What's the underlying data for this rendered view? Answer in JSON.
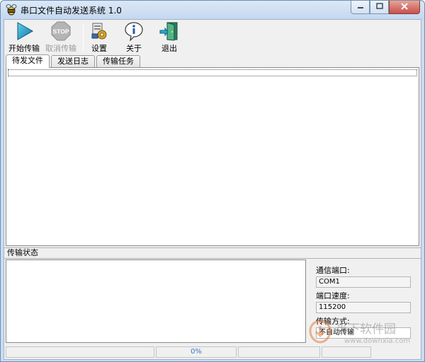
{
  "window": {
    "title": "串口文件自动发送系统 1.0",
    "minimize_icon": "minimize-icon",
    "maximize_icon": "maximize-icon",
    "close_icon": "close-icon"
  },
  "toolbar": {
    "start": {
      "label": "开始传输",
      "icon": "play-icon",
      "enabled": true
    },
    "cancel": {
      "label": "取消传输",
      "icon": "stop-icon",
      "enabled": false
    },
    "settings": {
      "label": "设置",
      "icon": "settings-icon",
      "enabled": true
    },
    "about": {
      "label": "关于",
      "icon": "info-icon",
      "enabled": true
    },
    "exit": {
      "label": "退出",
      "icon": "exit-door-icon",
      "enabled": true
    }
  },
  "tabs": [
    {
      "label": "待发文件",
      "active": true
    },
    {
      "label": "发送日志",
      "active": false
    },
    {
      "label": "传输任务",
      "active": false
    }
  ],
  "status_section": {
    "header": "传输状态",
    "port_label": "通信端口:",
    "port_value": "COM1",
    "speed_label": "端口速度:",
    "speed_value": "115200",
    "mode_label": "传输方式:",
    "mode_value": "不自动传输"
  },
  "statusbar": {
    "progress_text": "0%"
  },
  "watermark": {
    "text_cn": "当下软件园",
    "text_en": "www.downxia.com"
  },
  "colors": {
    "titlebar": "#c9dcf0",
    "close_button": "#c75050",
    "progress_text": "#3a7abf"
  }
}
